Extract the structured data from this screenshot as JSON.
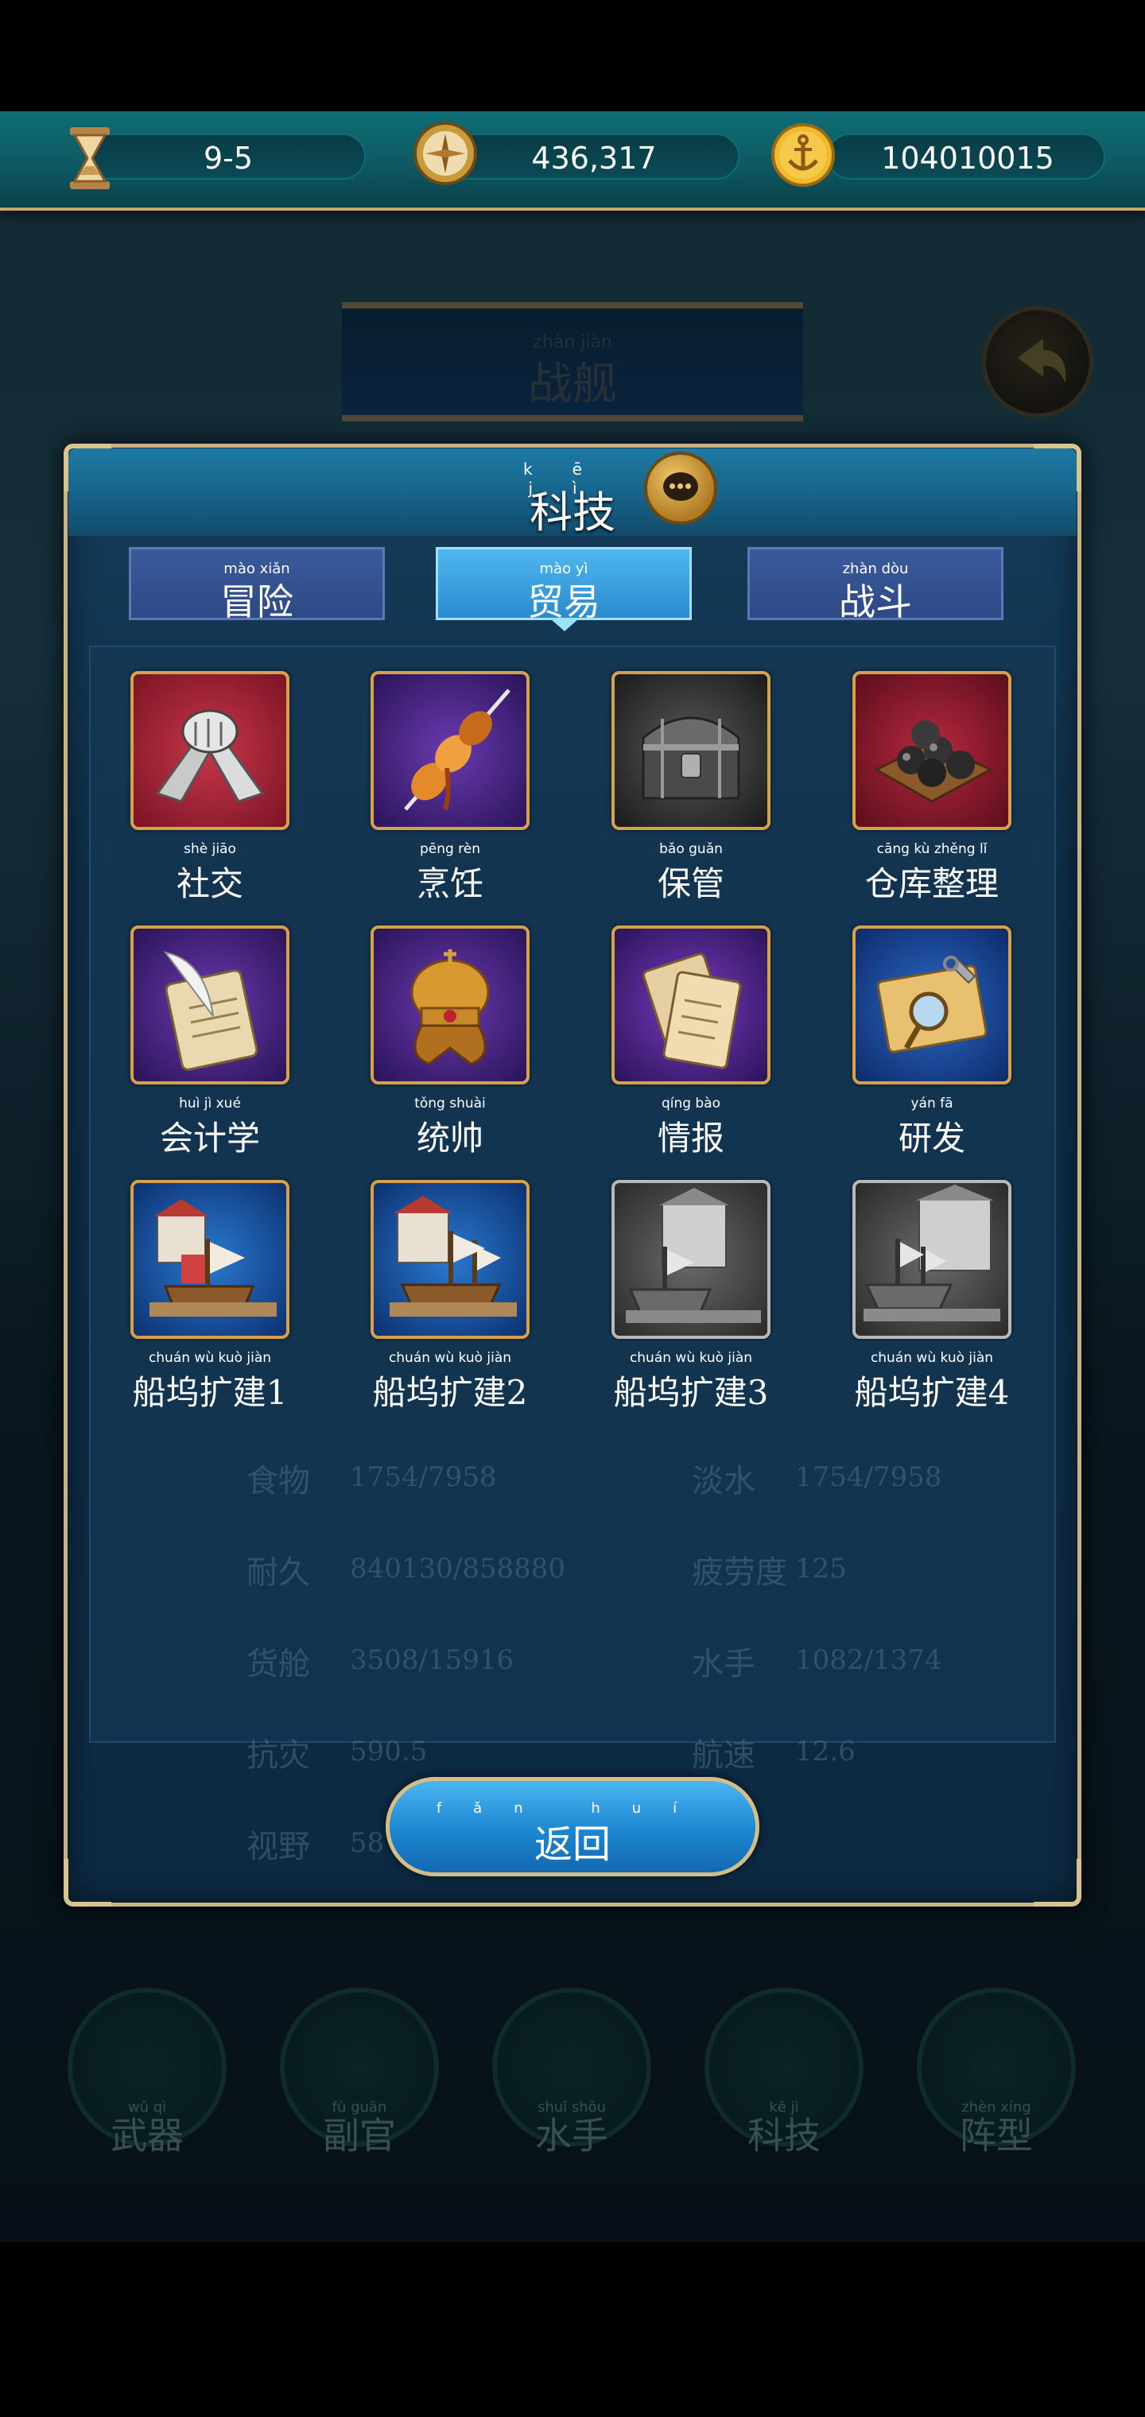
{
  "topbar": {
    "stage": "9-5",
    "compass_value": "436,317",
    "coin_value": "104010015"
  },
  "background": {
    "title": "战舰",
    "title_pinyin": "zhàn jiàn",
    "nav": [
      {
        "label": "武器",
        "pinyin": "wǔ qì"
      },
      {
        "label": "副官",
        "pinyin": "fù guān"
      },
      {
        "label": "水手",
        "pinyin": "shuǐ shǒu"
      },
      {
        "label": "科技",
        "pinyin": "kē jì"
      },
      {
        "label": "阵型",
        "pinyin": "zhèn xíng"
      }
    ],
    "stats": [
      {
        "name": "食物",
        "value": "1754/7958"
      },
      {
        "name": "淡水",
        "value": "1754/7958"
      },
      {
        "name": "耐久",
        "value": "840130/858880"
      },
      {
        "name": "疲劳度",
        "value": "125"
      },
      {
        "name": "货舱",
        "value": "3508/15916"
      },
      {
        "name": "水手",
        "value": "1082/1374"
      },
      {
        "name": "抗灾",
        "value": "590.5"
      },
      {
        "name": "航速",
        "value": "12.6"
      },
      {
        "name": "视野",
        "value": "58"
      }
    ]
  },
  "panel": {
    "title": "科技",
    "title_pinyin": "kē jì",
    "tabs": [
      {
        "label": "冒险",
        "pinyin": "mào xiǎn",
        "active": false
      },
      {
        "label": "贸易",
        "pinyin": "mào yì",
        "active": true
      },
      {
        "label": "战斗",
        "pinyin": "zhàn dòu",
        "active": false
      }
    ],
    "techs": [
      {
        "label": "社交",
        "pinyin": "shè jiāo",
        "icon": "handshake-icon",
        "locked": false
      },
      {
        "label": "烹饪",
        "pinyin": "pēng rèn",
        "icon": "skewer-icon",
        "locked": false
      },
      {
        "label": "保管",
        "pinyin": "bǎo guǎn",
        "icon": "chest-icon",
        "locked": false
      },
      {
        "label": "仓库整理",
        "pinyin": "cāng kù zhěng lǐ",
        "icon": "cannonballs-icon",
        "locked": false
      },
      {
        "label": "会计学",
        "pinyin": "huì jì xué",
        "icon": "quill-scroll-icon",
        "locked": false
      },
      {
        "label": "统帅",
        "pinyin": "tǒng shuài",
        "icon": "crown-icon",
        "locked": false
      },
      {
        "label": "情报",
        "pinyin": "qíng bào",
        "icon": "scrolls-icon",
        "locked": false
      },
      {
        "label": "研发",
        "pinyin": "yán fā",
        "icon": "research-icon",
        "locked": false
      },
      {
        "label": "船坞扩建1",
        "pinyin": "chuán wù kuò jiàn",
        "icon": "dock-icon",
        "locked": false
      },
      {
        "label": "船坞扩建2",
        "pinyin": "chuán wù kuò jiàn",
        "icon": "dock-icon",
        "locked": false
      },
      {
        "label": "船坞扩建3",
        "pinyin": "chuán wù kuò jiàn",
        "icon": "dock-icon",
        "locked": true
      },
      {
        "label": "船坞扩建4",
        "pinyin": "chuán wù kuò jiàn",
        "icon": "dock-icon",
        "locked": true
      }
    ],
    "return_label": "返回",
    "return_pinyin": "fǎn huí"
  },
  "colors": {
    "accent_gold": "#d7a14a",
    "active_tab": "#2a8bd0",
    "panel_bg": "#0f2e48"
  }
}
